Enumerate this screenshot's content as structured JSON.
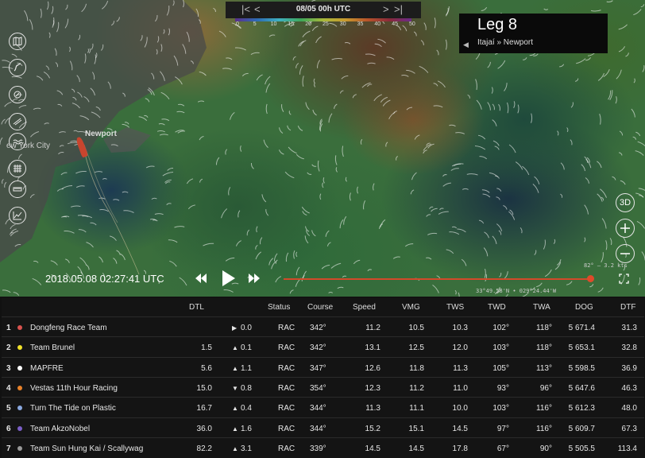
{
  "timebar": {
    "date": "08/05 00h UTC",
    "first": "|<",
    "prev": "<",
    "next": ">",
    "last": ">|"
  },
  "wind_scale": {
    "labels": [
      "0",
      "5",
      "10",
      "15",
      "20",
      "25",
      "30",
      "35",
      "40",
      "45",
      "50"
    ]
  },
  "leg": {
    "title": "Leg 8",
    "route": "Itajaí » Newport",
    "back_icon": "chevron-left-icon"
  },
  "places": {
    "newport": "Newport",
    "city": "ew York City"
  },
  "side_tools": [
    "map-icon",
    "route-icon",
    "compass-icon",
    "wind-icon",
    "wave-icon",
    "grid-icon",
    "ruler-icon",
    "chart-icon"
  ],
  "right_tools": {
    "mode_3d": "3D",
    "zoom_in": "plus-icon",
    "zoom_out": "minus-icon"
  },
  "playback": {
    "timestamp": "2018.05.08 02:27:41 UTC",
    "progress": 0.99
  },
  "windinfo": "82° – 3.2 kts",
  "coords": "33°49.58'N • 029°24.44'W",
  "table": {
    "headers": {
      "dtl": "DTL",
      "status": "Status",
      "course": "Course",
      "speed": "Speed",
      "vmg": "VMG",
      "tws": "TWS",
      "twd": "TWD",
      "twa": "TWA",
      "dog": "DOG",
      "dtf": "DTF"
    },
    "rows": [
      {
        "rank": "1",
        "color": "#d9534f",
        "team": "Dongfeng Race Team",
        "dtl": "",
        "trend": "flat",
        "delta": "0.0",
        "status": "RAC",
        "course": "342°",
        "speed": "11.2",
        "vmg": "10.5",
        "tws": "10.3",
        "twd": "102°",
        "twa": "118°",
        "dog": "5 671.4",
        "dtf": "31.3"
      },
      {
        "rank": "2",
        "color": "#f2e22a",
        "team": "Team Brunel",
        "dtl": "1.5",
        "trend": "up",
        "delta": "0.1",
        "status": "RAC",
        "course": "342°",
        "speed": "13.1",
        "vmg": "12.5",
        "tws": "12.0",
        "twd": "103°",
        "twa": "118°",
        "dog": "5 653.1",
        "dtf": "32.8"
      },
      {
        "rank": "3",
        "color": "#ffffff",
        "team": "MAPFRE",
        "dtl": "5.6",
        "trend": "up",
        "delta": "1.1",
        "status": "RAC",
        "course": "347°",
        "speed": "12.6",
        "vmg": "11.8",
        "tws": "11.3",
        "twd": "105°",
        "twa": "113°",
        "dog": "5 598.5",
        "dtf": "36.9"
      },
      {
        "rank": "4",
        "color": "#e8822a",
        "team": "Vestas 11th Hour Racing",
        "dtl": "15.0",
        "trend": "down",
        "delta": "0.8",
        "status": "RAC",
        "course": "354°",
        "speed": "12.3",
        "vmg": "11.2",
        "tws": "11.0",
        "twd": "93°",
        "twa": "96°",
        "dog": "5 647.6",
        "dtf": "46.3"
      },
      {
        "rank": "5",
        "color": "#8aa8e0",
        "team": "Turn The Tide on Plastic",
        "dtl": "16.7",
        "trend": "up",
        "delta": "0.4",
        "status": "RAC",
        "course": "344°",
        "speed": "11.3",
        "vmg": "11.1",
        "tws": "10.0",
        "twd": "103°",
        "twa": "116°",
        "dog": "5 612.3",
        "dtf": "48.0"
      },
      {
        "rank": "6",
        "color": "#7b5fc8",
        "team": "Team AkzoNobel",
        "dtl": "36.0",
        "trend": "up",
        "delta": "1.6",
        "status": "RAC",
        "course": "344°",
        "speed": "15.2",
        "vmg": "15.1",
        "tws": "14.5",
        "twd": "97°",
        "twa": "116°",
        "dog": "5 609.7",
        "dtf": "67.3"
      },
      {
        "rank": "7",
        "color": "#999999",
        "team": "Team Sun Hung Kai / Scallywag",
        "dtl": "82.2",
        "trend": "up",
        "delta": "3.1",
        "status": "RAC",
        "course": "339°",
        "speed": "14.5",
        "vmg": "14.5",
        "tws": "17.8",
        "twd": "67°",
        "twa": "90°",
        "dog": "5 505.5",
        "dtf": "113.4"
      }
    ]
  }
}
